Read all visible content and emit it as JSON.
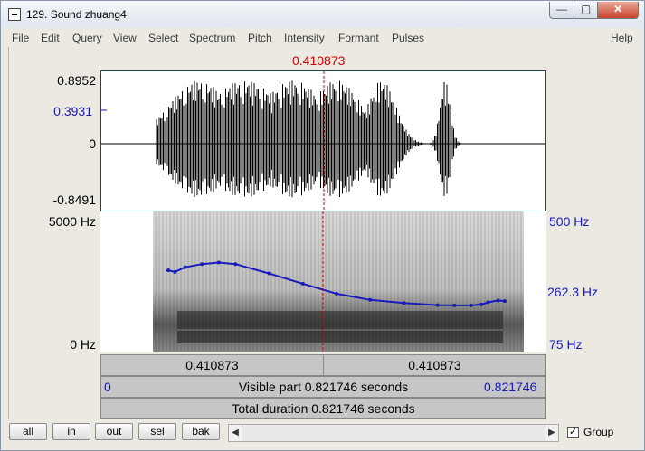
{
  "window": {
    "title": "129. Sound zhuang4",
    "controls": {
      "minimize": "—",
      "maximize": "▢",
      "close": "✕"
    }
  },
  "menu": [
    "File",
    "Edit",
    "Query",
    "View",
    "Select",
    "Spectrum",
    "Pitch",
    "Intensity",
    "Formant",
    "Pulses",
    "Help"
  ],
  "cursor": {
    "time_label": "0.410873"
  },
  "waveform": {
    "y_max": "0.8952",
    "y_mark": "0.3931",
    "y_zero": "0",
    "y_min": "-0.8491"
  },
  "spectrogram": {
    "freq_top": "5000 Hz",
    "freq_bottom": "0 Hz",
    "pitch_top": "500 Hz",
    "pitch_mid": "262.3 Hz",
    "pitch_bottom": "75 Hz"
  },
  "segments": {
    "left_duration": "0.410873",
    "right_duration": "0.410873",
    "visible_start": "0",
    "visible_end": "0.821746",
    "visible_text": "Visible part 0.821746 seconds",
    "total_text": "Total duration 0.821746 seconds"
  },
  "buttons": {
    "all": "all",
    "in": "in",
    "out": "out",
    "sel": "sel",
    "bak": "bak"
  },
  "group": {
    "label": "Group",
    "checked": true
  },
  "colors": {
    "cursor": "#cc0000",
    "pitch": "#1a1ab8"
  },
  "chart_data": {
    "type": "line",
    "pitch_series": {
      "time_fraction": [
        0.0,
        0.02,
        0.05,
        0.1,
        0.15,
        0.2,
        0.3,
        0.4,
        0.5,
        0.6,
        0.7,
        0.8,
        0.85,
        0.9,
        0.93,
        0.95,
        0.98,
        1.0
      ],
      "hz": [
        325,
        320,
        335,
        345,
        350,
        345,
        315,
        282,
        250,
        230,
        220,
        213,
        212,
        212,
        215,
        222,
        228,
        226
      ]
    },
    "pitch_axis_range": [
      75,
      500
    ],
    "waveform_range": [
      -0.8491,
      0.8952
    ]
  }
}
